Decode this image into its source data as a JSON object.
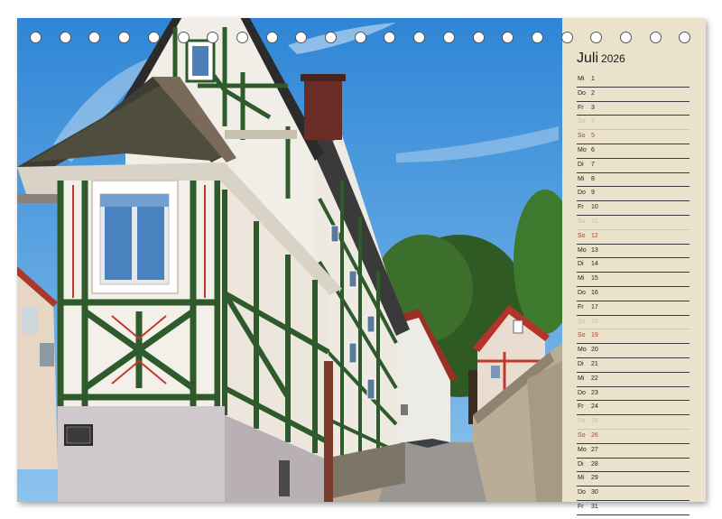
{
  "calendar": {
    "month": "Juli",
    "year": "2026",
    "days": [
      {
        "wd": "Mi",
        "d": "1",
        "type": "weekday"
      },
      {
        "wd": "Do",
        "d": "2",
        "type": "weekday"
      },
      {
        "wd": "Fr",
        "d": "3",
        "type": "weekday"
      },
      {
        "wd": "Sa",
        "d": "4",
        "type": "sat"
      },
      {
        "wd": "So",
        "d": "5",
        "type": "sun"
      },
      {
        "wd": "Mo",
        "d": "6",
        "type": "weekday"
      },
      {
        "wd": "Di",
        "d": "7",
        "type": "weekday"
      },
      {
        "wd": "Mi",
        "d": "8",
        "type": "weekday"
      },
      {
        "wd": "Do",
        "d": "9",
        "type": "weekday"
      },
      {
        "wd": "Fr",
        "d": "10",
        "type": "weekday"
      },
      {
        "wd": "Sa",
        "d": "11",
        "type": "sat"
      },
      {
        "wd": "So",
        "d": "12",
        "type": "sun"
      },
      {
        "wd": "Mo",
        "d": "13",
        "type": "weekday"
      },
      {
        "wd": "Di",
        "d": "14",
        "type": "weekday"
      },
      {
        "wd": "Mi",
        "d": "15",
        "type": "weekday"
      },
      {
        "wd": "Do",
        "d": "16",
        "type": "weekday"
      },
      {
        "wd": "Fr",
        "d": "17",
        "type": "weekday"
      },
      {
        "wd": "Sa",
        "d": "18",
        "type": "sat"
      },
      {
        "wd": "So",
        "d": "19",
        "type": "sun"
      },
      {
        "wd": "Mo",
        "d": "20",
        "type": "weekday"
      },
      {
        "wd": "Di",
        "d": "21",
        "type": "weekday"
      },
      {
        "wd": "Mi",
        "d": "22",
        "type": "weekday"
      },
      {
        "wd": "Do",
        "d": "23",
        "type": "weekday"
      },
      {
        "wd": "Fr",
        "d": "24",
        "type": "weekday"
      },
      {
        "wd": "Sa",
        "d": "25",
        "type": "sat"
      },
      {
        "wd": "So",
        "d": "26",
        "type": "sun"
      },
      {
        "wd": "Mo",
        "d": "27",
        "type": "weekday"
      },
      {
        "wd": "Di",
        "d": "28",
        "type": "weekday"
      },
      {
        "wd": "Mi",
        "d": "29",
        "type": "weekday"
      },
      {
        "wd": "Do",
        "d": "30",
        "type": "weekday"
      },
      {
        "wd": "Fr",
        "d": "31",
        "type": "weekday"
      }
    ]
  },
  "colors": {
    "panel_background": "#ebe2cc",
    "sunday": "#c0392b",
    "saturday": "#c8c0ae",
    "timber_green": "#2f5a2c",
    "sky": "#4a9ad8"
  },
  "photo": {
    "sign_text": "",
    "subject_icon": "half-timbered-house-image"
  },
  "binding": {
    "ring_count": 23,
    "icon": "spiral-ring-icon"
  }
}
